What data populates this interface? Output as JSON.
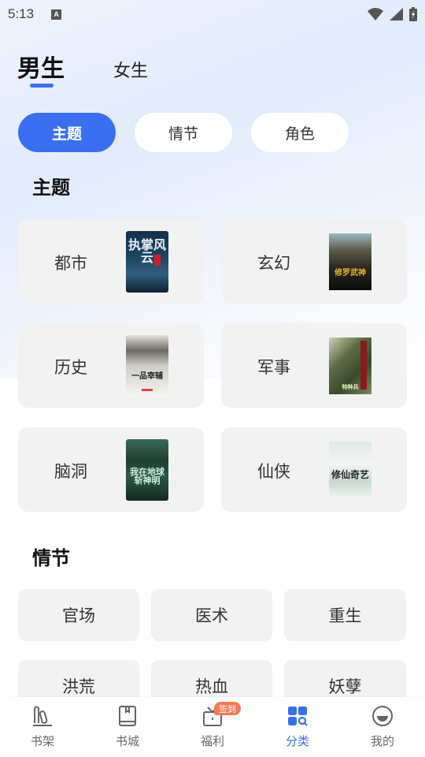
{
  "status_bar": {
    "time": "5:13",
    "indicator_icon": "keyboard-a-icon",
    "icons": [
      "wifi-icon",
      "signal-icon",
      "battery-charging-icon"
    ]
  },
  "gender_tabs": [
    {
      "label": "男生",
      "active": true
    },
    {
      "label": "女生",
      "active": false
    }
  ],
  "filter_chips": [
    {
      "label": "主题",
      "active": true
    },
    {
      "label": "情节",
      "active": false
    },
    {
      "label": "角色",
      "active": false
    }
  ],
  "theme_section": {
    "title": "主题",
    "items": [
      {
        "label": "都市",
        "cover_text": "执掌风云",
        "cover_colors": [
          "#0d2740",
          "#2c5c7c"
        ]
      },
      {
        "label": "玄幻",
        "cover_text": "修罗武神",
        "cover_colors": [
          "#2a2a28",
          "#8a8a70"
        ]
      },
      {
        "label": "历史",
        "cover_text": "一品宰辅",
        "cover_colors": [
          "#e8e8e6",
          "#7a7670"
        ]
      },
      {
        "label": "军事",
        "cover_text": "特种兵",
        "cover_colors": [
          "#4a5a3c",
          "#c7c7a8"
        ]
      },
      {
        "label": "脑洞",
        "cover_text": "我在地球斩神明",
        "cover_colors": [
          "#1d3c2c",
          "#4c8a6a"
        ]
      },
      {
        "label": "仙侠",
        "cover_text": "修仙奇艺",
        "cover_colors": [
          "#f0f4f2",
          "#a9c4b6"
        ]
      }
    ]
  },
  "plot_section": {
    "title": "情节",
    "items": [
      "官场",
      "医术",
      "重生",
      "洪荒",
      "热血",
      "妖孽"
    ]
  },
  "bottom_nav": {
    "items": [
      {
        "label": "书架",
        "icon": "bookshelf-icon",
        "active": false
      },
      {
        "label": "书城",
        "icon": "book-icon",
        "active": false
      },
      {
        "label": "福利",
        "icon": "gift-icon",
        "active": false,
        "badge": "签到"
      },
      {
        "label": "分类",
        "icon": "category-icon",
        "active": true
      },
      {
        "label": "我的",
        "icon": "profile-icon",
        "active": false
      }
    ]
  },
  "colors": {
    "accent": "#3b6ff0",
    "badge": "#f47a55",
    "card_bg": "#f2f2f2"
  }
}
